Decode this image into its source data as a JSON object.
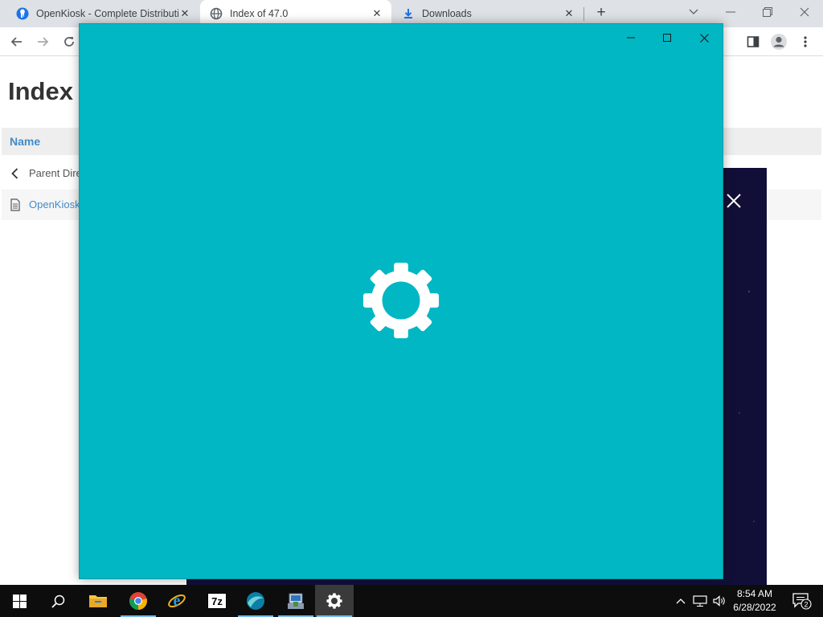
{
  "browser": {
    "tabs": [
      {
        "title": "OpenKiosk - Complete Distributi",
        "favicon": "openkiosk-icon",
        "active": false
      },
      {
        "title": "Index of 47.0",
        "favicon": "globe-icon",
        "active": true
      },
      {
        "title": "Downloads",
        "favicon": "download-icon",
        "active": false
      }
    ]
  },
  "page": {
    "title": "Index",
    "table_header": "Name",
    "rows": [
      {
        "label": "Parent Dire",
        "icon": "chevron-left-icon"
      },
      {
        "label": "OpenKiosk",
        "icon": "document-icon"
      }
    ]
  },
  "splash": {
    "background_color": "#00b7c3",
    "icon": "gear-icon"
  },
  "taskbar": {
    "apps": [
      "start-icon",
      "search-icon",
      "file-explorer-icon",
      "chrome-icon",
      "internet-explorer-icon",
      "7zip-icon",
      "openkiosk-icon",
      "installer-icon",
      "settings-icon"
    ],
    "zip_label": "7z",
    "clock_time": "8:54 AM",
    "clock_date": "6/28/2022",
    "notification_count": "2"
  },
  "colors": {
    "tabstrip": "#dee1e6",
    "link": "#428bca",
    "dark_window": "#110f38",
    "taskbar": "#0d0d0d"
  }
}
